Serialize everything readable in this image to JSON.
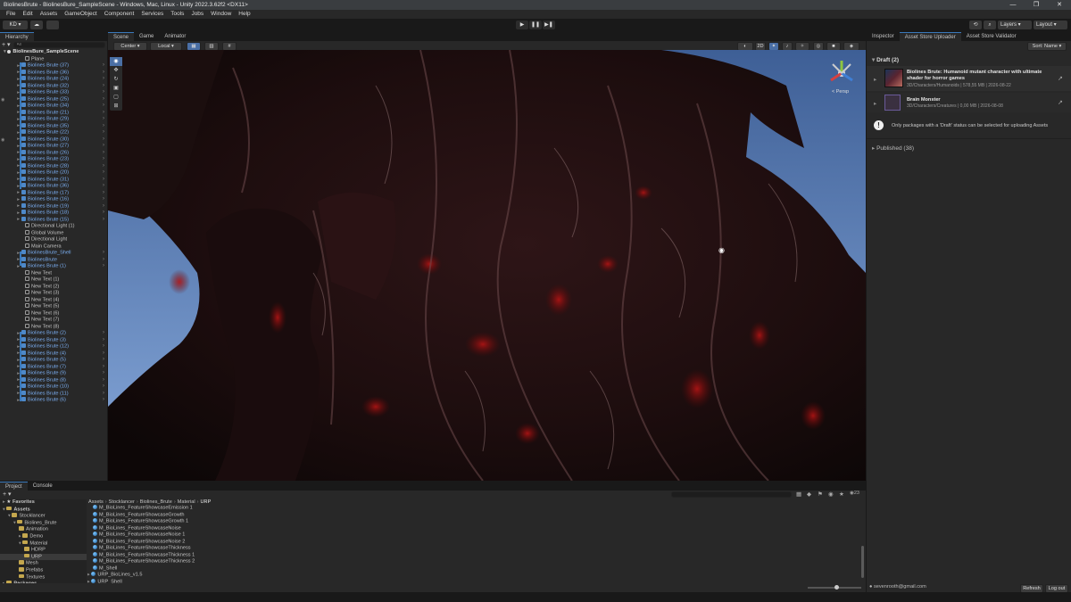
{
  "window": {
    "title": "BiolinesBrute - BiolinesBure_SampleScene - Windows, Mac, Linux - Unity 2022.3.62f2 <DX11>",
    "controls": [
      "—",
      "❐",
      "✕"
    ]
  },
  "menu": [
    "File",
    "Edit",
    "Assets",
    "GameObject",
    "Component",
    "Services",
    "Tools",
    "Jobs",
    "Window",
    "Help"
  ],
  "toolbar": {
    "account": "KD ▾",
    "play": "▶",
    "pause": "❚❚",
    "step": "▶❚",
    "layers": "Layers",
    "layout": "Layout"
  },
  "hierarchy": {
    "tab": "Hierarchy",
    "search_placeholder": "All",
    "scene": "BiolinesBure_SampleScene",
    "items": [
      {
        "label": "Plane",
        "blue": false
      },
      {
        "label": "Biolines Brute (37)",
        "blue": true
      },
      {
        "label": "Biolines Brute (36)",
        "blue": true
      },
      {
        "label": "Biolines Brute (24)",
        "blue": true
      },
      {
        "label": "Biolines Brute (32)",
        "blue": true
      },
      {
        "label": "Biolines Brute (33)",
        "blue": true
      },
      {
        "label": "Biolines Brute (25)",
        "blue": true
      },
      {
        "label": "Biolines Brute (34)",
        "blue": true
      },
      {
        "label": "Biolines Brute (21)",
        "blue": true
      },
      {
        "label": "Biolines Brute (29)",
        "blue": true
      },
      {
        "label": "Biolines Brute (35)",
        "blue": true
      },
      {
        "label": "Biolines Brute (22)",
        "blue": true
      },
      {
        "label": "Biolines Brute (30)",
        "blue": true
      },
      {
        "label": "Biolines Brute (27)",
        "blue": true
      },
      {
        "label": "Biolines Brute (26)",
        "blue": true
      },
      {
        "label": "Biolines Brute (23)",
        "blue": true
      },
      {
        "label": "Biolines Brute (28)",
        "blue": true
      },
      {
        "label": "Biolines Brute (20)",
        "blue": true
      },
      {
        "label": "Biolines Brute (31)",
        "blue": true
      },
      {
        "label": "Biolines Brute (36)",
        "blue": true
      },
      {
        "label": "Biolines Brute (17)",
        "blue": true
      },
      {
        "label": "Biolines Brute (16)",
        "blue": true
      },
      {
        "label": "Biolines Brute (19)",
        "blue": true
      },
      {
        "label": "Biolines Brute (18)",
        "blue": true
      },
      {
        "label": "Biolines Brute (15)",
        "blue": true
      },
      {
        "label": "Directional Light (1)",
        "blue": false
      },
      {
        "label": "Global Volume",
        "blue": false
      },
      {
        "label": "Directional Light",
        "blue": false
      },
      {
        "label": "Main Camera",
        "blue": false
      },
      {
        "label": "BiolinesBrute_Shell",
        "blue": true
      },
      {
        "label": "BiolinesBrute",
        "blue": true
      },
      {
        "label": "Biolines Brute (1)",
        "blue": true
      },
      {
        "label": "New Text",
        "blue": false
      },
      {
        "label": "New Text (1)",
        "blue": false
      },
      {
        "label": "New Text (2)",
        "blue": false
      },
      {
        "label": "New Text (3)",
        "blue": false
      },
      {
        "label": "New Text (4)",
        "blue": false
      },
      {
        "label": "New Text (5)",
        "blue": false
      },
      {
        "label": "New Text (6)",
        "blue": false
      },
      {
        "label": "New Text (7)",
        "blue": false
      },
      {
        "label": "New Text (8)",
        "blue": false
      },
      {
        "label": "Biolines Brute (2)",
        "blue": true
      },
      {
        "label": "Biolines Brute (3)",
        "blue": true
      },
      {
        "label": "Biolines Brute (12)",
        "blue": true
      },
      {
        "label": "Biolines Brute (4)",
        "blue": true
      },
      {
        "label": "Biolines Brute (5)",
        "blue": true
      },
      {
        "label": "Biolines Brute (7)",
        "blue": true
      },
      {
        "label": "Biolines Brute (9)",
        "blue": true
      },
      {
        "label": "Biolines Brute (8)",
        "blue": true
      },
      {
        "label": "Biolines Brute (10)",
        "blue": true
      },
      {
        "label": "Biolines Brute (11)",
        "blue": true
      },
      {
        "label": "Biolines Brute (6)",
        "blue": true
      }
    ]
  },
  "scene_view": {
    "tabs": [
      "Scene",
      "Game",
      "Animator"
    ],
    "pivot": "Center ▾",
    "space": "Local ▾",
    "mode_2d": "2D",
    "persp": "< Persp"
  },
  "inspector": {
    "tabs": [
      "Inspector",
      "Asset Store Uploader",
      "Asset Store Validator"
    ],
    "sort": "Sort: Name ▾",
    "draft_header": "Draft (2)",
    "packages": [
      {
        "name": "Biolines Brute: Humanoid mutant character with ultimate shader for horror games",
        "meta": "3D/Characters/Humanoids  |  578,55 MB  |  2026-08-22"
      },
      {
        "name": "Brain Monster",
        "meta": "3D/Characters/Creatures  |  0,00 MB  |  2026-08-08"
      }
    ],
    "info": "Only packages with a 'Draft' status can be selected for uploading Assets",
    "published_header": "Published (38)",
    "account": "sevenrooth@gmail.com",
    "refresh": "Refresh",
    "logout": "Log out"
  },
  "project": {
    "tabs": [
      "Project",
      "Console"
    ],
    "count": "23",
    "breadcrumb": [
      "Assets",
      "Stocklancer",
      "Biolines_Brute",
      "Material",
      "URP"
    ],
    "tree": [
      {
        "label": "Favorites",
        "level": 0,
        "star": true
      },
      {
        "label": "Assets",
        "level": 0
      },
      {
        "label": "Stocklancer",
        "level": 1
      },
      {
        "label": "Biolines_Brute",
        "level": 2
      },
      {
        "label": "Animation",
        "level": 3
      },
      {
        "label": "Demo",
        "level": 3
      },
      {
        "label": "Material",
        "level": 3
      },
      {
        "label": "HDRP",
        "level": 4
      },
      {
        "label": "URP",
        "level": 4,
        "selected": true
      },
      {
        "label": "Mesh",
        "level": 3
      },
      {
        "label": "Prefabs",
        "level": 3
      },
      {
        "label": "Textures",
        "level": 3
      },
      {
        "label": "Packages",
        "level": 0
      }
    ],
    "files": [
      "M_BioLines_FeatureShowcaseEmission 1",
      "M_BioLines_FeatureShowcaseGrowth",
      "M_BioLines_FeatureShowcaseGrowth 1",
      "M_BioLines_FeatureShowcaseNoise",
      "M_BioLines_FeatureShowcaseNoise 1",
      "M_BioLines_FeatureShowcaseNoise 2",
      "M_BioLines_FeatureShowcaseThickness",
      "M_BioLines_FeatureShowcaseThickness 1",
      "M_BioLines_FeatureShowcaseThickness 2",
      "M_Shell",
      "URP_BioLines_v1.5",
      "URP_Shell"
    ]
  },
  "colors": {
    "accent": "#3a79bb",
    "prefab_text": "#7cb0f4",
    "sky": "#6e93c4"
  }
}
